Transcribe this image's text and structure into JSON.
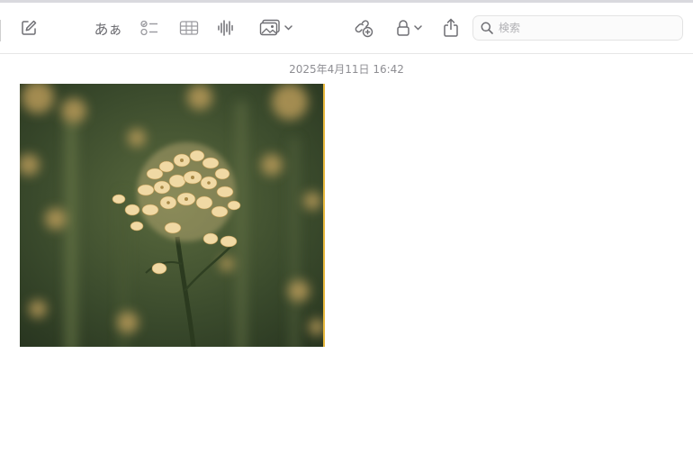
{
  "toolbar": {
    "format_label": "あぁ",
    "search": {
      "placeholder": "検索",
      "value": ""
    },
    "icons": {
      "compose": "compose-icon",
      "checklist": "checklist-icon",
      "table": "table-icon",
      "audio": "waveform-icon",
      "media": "photo-icon",
      "collaborate": "collaborate-icon",
      "lock": "lock-icon",
      "share": "share-icon",
      "search": "search-icon"
    }
  },
  "note": {
    "timestamp": "2025年4月11日 16:42",
    "attachment": {
      "type": "image",
      "subject": "photo-attachment",
      "accent_border": "#e7b73b"
    }
  },
  "colors": {
    "toolbar_icon": "#6e6e73",
    "timestamp_text": "#8e8e93"
  }
}
